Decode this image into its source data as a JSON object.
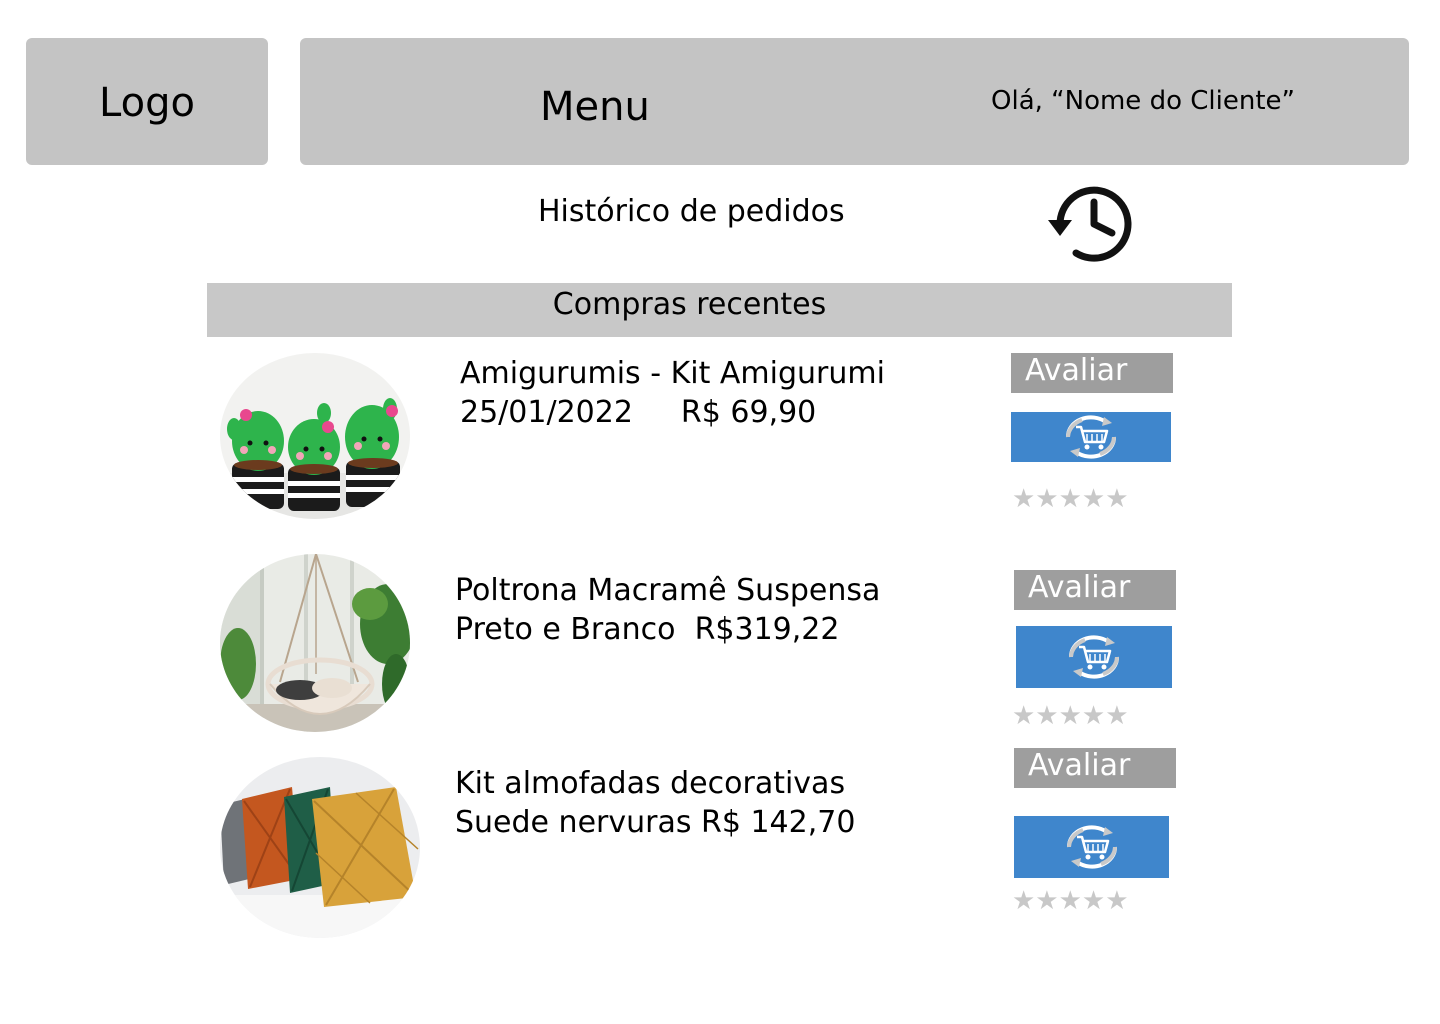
{
  "header": {
    "logo_label": "Logo",
    "menu_label": "Menu",
    "greeting": "Olá, “Nome do Cliente”"
  },
  "history": {
    "title": "Histórico de pedidos",
    "icon": "history-icon"
  },
  "recent": {
    "title": "Compras recentes"
  },
  "orders": [
    {
      "line1": "Amigurumis - Kit Amigurumi",
      "date": "25/01/2022",
      "price": "R$ 69,90",
      "image": "amigurumi-cactus-photo",
      "rate_label": "Avaliar",
      "reorder_icon": "cart-reorder-icon",
      "rating": 0,
      "stars": "★★★★★"
    },
    {
      "line1": "Poltrona Macramê Suspensa",
      "line2": "Preto e Branco  R$319,22",
      "image": "macrame-chair-photo",
      "rate_label": "Avaliar",
      "reorder_icon": "cart-reorder-icon",
      "rating": 0,
      "stars": "★★★★★"
    },
    {
      "line1": "Kit almofadas decorativas",
      "line2": "Suede nervuras R$ 142,70",
      "image": "cushions-photo",
      "rate_label": "Avaliar",
      "reorder_icon": "cart-reorder-icon",
      "rating": 0,
      "stars": "★★★★★"
    }
  ],
  "colors": {
    "header_gray": "#c4c4c4",
    "avaliar_gray": "#9e9e9e",
    "reorder_blue": "#3f86cc",
    "star_gray": "#c8c8c8"
  }
}
